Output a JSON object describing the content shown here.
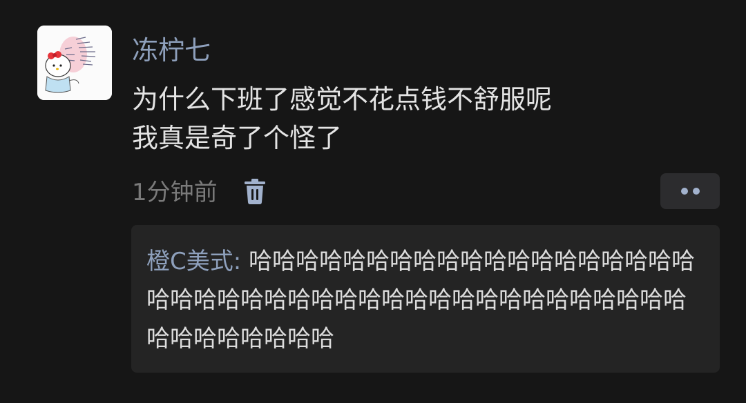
{
  "post": {
    "username": "冻柠七",
    "content_lines": [
      "为什么下班了感觉不花点钱不舒服呢",
      "我真是奇了个怪了"
    ],
    "time": "1分钟前",
    "icons": {
      "avatar": "avatar-cartoon-icon",
      "delete": "trash-icon",
      "more": "more-dots-icon"
    }
  },
  "reply": {
    "author": "橙C美式:",
    "text": " 哈哈哈哈哈哈哈哈哈哈哈哈哈哈哈哈哈哈哈哈哈哈哈哈哈哈哈哈哈哈哈哈哈哈哈哈哈哈哈哈哈哈哈哈哈哈哈哈哈哈"
  },
  "colors": {
    "background": "#161616",
    "link": "#8ea0bc",
    "text": "#e4e4e4",
    "muted": "#7a7a7a",
    "reply_bg": "#242424"
  }
}
